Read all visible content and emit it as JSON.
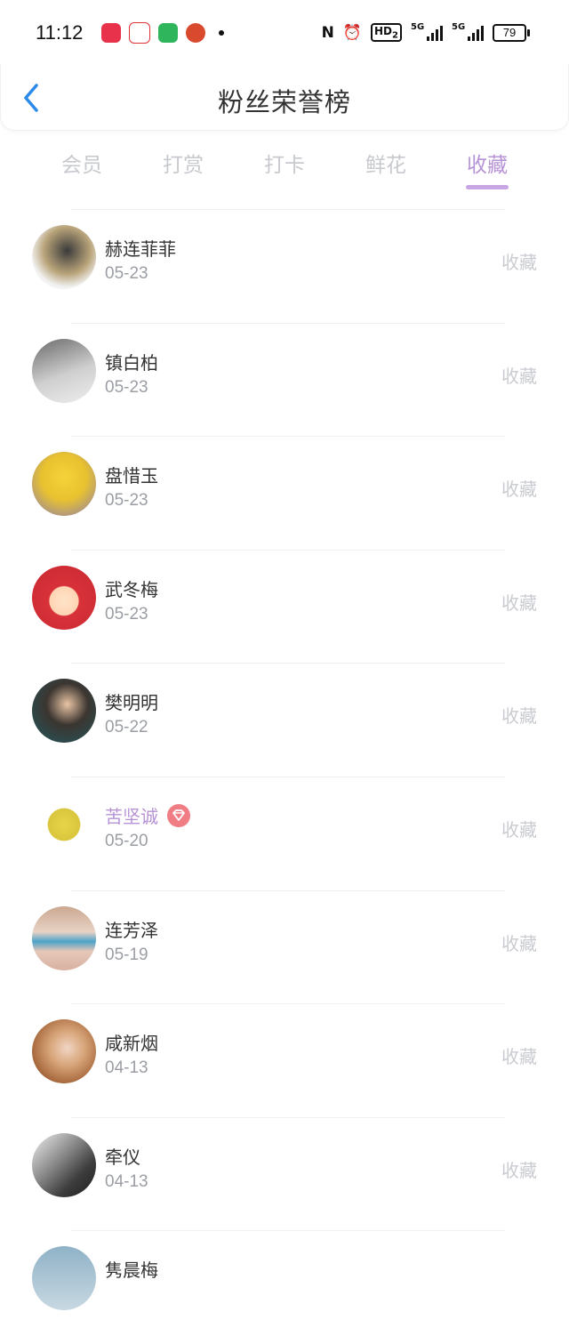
{
  "status_bar": {
    "time": "11:12",
    "battery": "79",
    "network_1": "5G",
    "network_2": "5G",
    "hd_label": "HD",
    "hd_sub": "2",
    "icons": [
      "nfc-icon",
      "alarm-icon",
      "hd-voice-icon",
      "signal-icon",
      "signal-icon",
      "battery-icon"
    ]
  },
  "header": {
    "title": "粉丝荣誉榜",
    "back_icon": "chevron-left-icon"
  },
  "tabs": [
    {
      "label": "会员",
      "active": false
    },
    {
      "label": "打赏",
      "active": false
    },
    {
      "label": "打卡",
      "active": false
    },
    {
      "label": "鲜花",
      "active": false
    },
    {
      "label": "收藏",
      "active": true
    }
  ],
  "colors": {
    "accent": "#b793d6",
    "underline": "#c8a5e3",
    "inactive_tab": "#c7c9ce",
    "text": "#333333",
    "date": "#9b9ea5",
    "action": "#c9cbd0",
    "vip_badge": "#f07d84"
  },
  "fans": [
    {
      "name": "赫连菲菲",
      "date": "05-23",
      "action": "收藏",
      "vip": false
    },
    {
      "name": "镇白柏",
      "date": "05-23",
      "action": "收藏",
      "vip": false
    },
    {
      "name": "盘惜玉",
      "date": "05-23",
      "action": "收藏",
      "vip": false
    },
    {
      "name": "武冬梅",
      "date": "05-23",
      "action": "收藏",
      "vip": false
    },
    {
      "name": "樊明明",
      "date": "05-22",
      "action": "收藏",
      "vip": false
    },
    {
      "name": "苦坚诚",
      "date": "05-20",
      "action": "收藏",
      "vip": true
    },
    {
      "name": "连芳泽",
      "date": "05-19",
      "action": "收藏",
      "vip": false
    },
    {
      "name": "咸新烟",
      "date": "04-13",
      "action": "收藏",
      "vip": false
    },
    {
      "name": "牵仪",
      "date": "04-13",
      "action": "收藏",
      "vip": false
    },
    {
      "name": "隽晨梅",
      "date": "",
      "action": "",
      "vip": false
    }
  ]
}
